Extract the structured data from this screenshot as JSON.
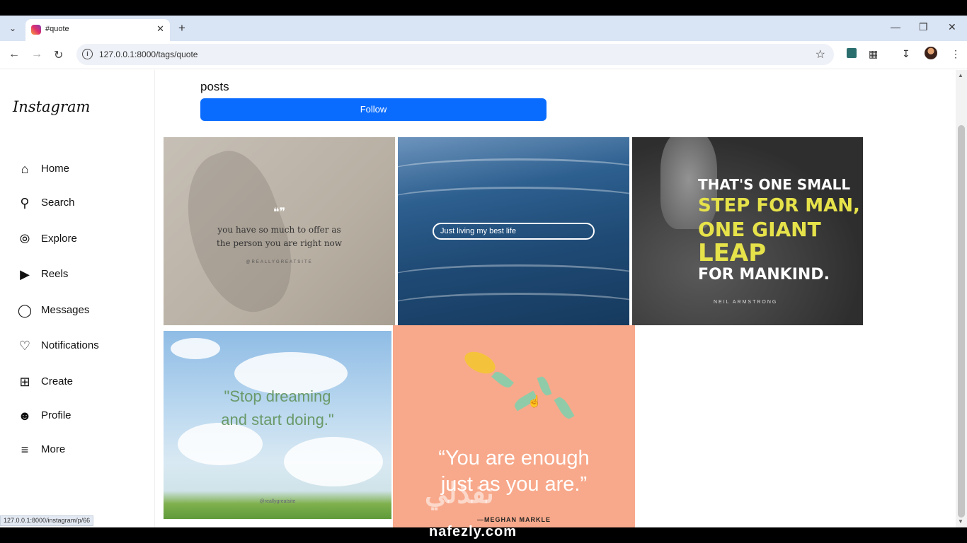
{
  "browser": {
    "tab_title": "#quote",
    "url": "127.0.0.1:8000/tags/quote",
    "status_url": "127.0.0.1:8000/instagram/p/66"
  },
  "sidebar": {
    "logo": "Instagram",
    "items": [
      {
        "label": "Home",
        "icon": "home-icon"
      },
      {
        "label": "Search",
        "icon": "search-icon"
      },
      {
        "label": "Explore",
        "icon": "compass-icon"
      },
      {
        "label": "Reels",
        "icon": "reels-icon"
      },
      {
        "label": "Messages",
        "icon": "messenger-icon"
      },
      {
        "label": "Notifications",
        "icon": "heart-icon"
      },
      {
        "label": "Create",
        "icon": "plus-square-icon"
      },
      {
        "label": "Profile",
        "icon": "person-icon"
      },
      {
        "label": "More",
        "icon": "menu-icon"
      }
    ]
  },
  "tag_header": {
    "posts_label": "posts",
    "follow_label": "Follow"
  },
  "posts": [
    {
      "line1": "you have so much to offer as",
      "line2": "the person you are right now",
      "site": "@REALLYGREATSITE"
    },
    {
      "text": "Just living my best life"
    },
    {
      "line1": "THAT'S ONE SMALL",
      "line2": "STEP FOR MAN,",
      "line3": "ONE GIANT",
      "line4": "LEAP",
      "line5": "FOR MANKIND.",
      "author": "NEIL ARMSTRONG"
    },
    {
      "line1": "\"Stop dreaming",
      "line2": "and start doing.\"",
      "credit": "@reallygreatsite"
    },
    {
      "line1": "“You are enough",
      "line2": "just as you are.”",
      "author": "—MEGHAN MARKLE"
    }
  ],
  "watermark": {
    "arabic": "نفذلي",
    "text": "nafezly.com"
  },
  "colors": {
    "accent": "#0a6cff",
    "tabbar": "#d9e4f5"
  }
}
